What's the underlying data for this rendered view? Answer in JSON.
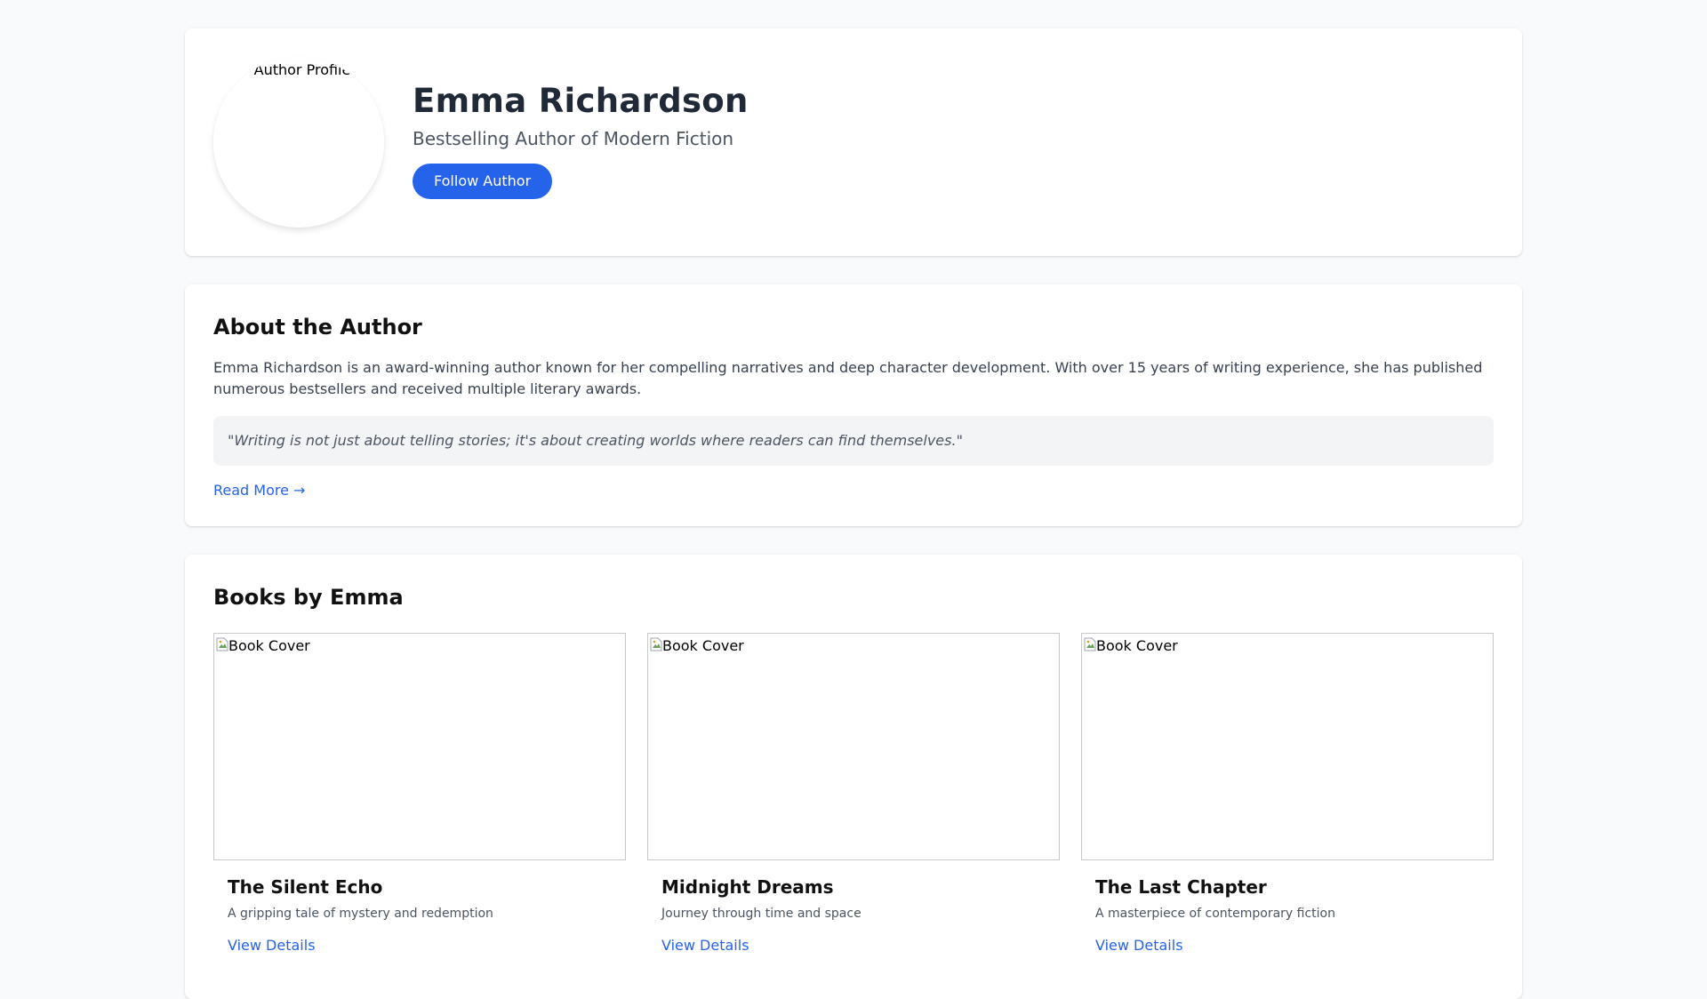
{
  "profile": {
    "avatar_alt": "Author Profile",
    "name": "Emma Richardson",
    "tagline": "Bestselling Author of Modern Fiction",
    "follow_label": "Follow Author"
  },
  "about": {
    "title": "About the Author",
    "text": "Emma Richardson is an award-winning author known for her compelling narratives and deep character development. With over 15 years of writing experience, she has published numerous bestsellers and received multiple literary awards.",
    "quote": "\"Writing is not just about telling stories; it's about creating worlds where readers can find themselves.\"",
    "read_more_label": "Read More →"
  },
  "books": {
    "title": "Books by Emma",
    "items": [
      {
        "cover_alt": "Book Cover",
        "title": "The Silent Echo",
        "description": "A gripping tale of mystery and redemption",
        "link_label": "View Details"
      },
      {
        "cover_alt": "Book Cover",
        "title": "Midnight Dreams",
        "description": "Journey through time and space",
        "link_label": "View Details"
      },
      {
        "cover_alt": "Book Cover",
        "title": "The Last Chapter",
        "description": "A masterpiece of contemporary fiction",
        "link_label": "View Details"
      }
    ]
  },
  "colors": {
    "accent": "#2563eb",
    "page_background": "#f9fafb",
    "card_background": "#ffffff",
    "quote_background": "#f3f4f6"
  }
}
